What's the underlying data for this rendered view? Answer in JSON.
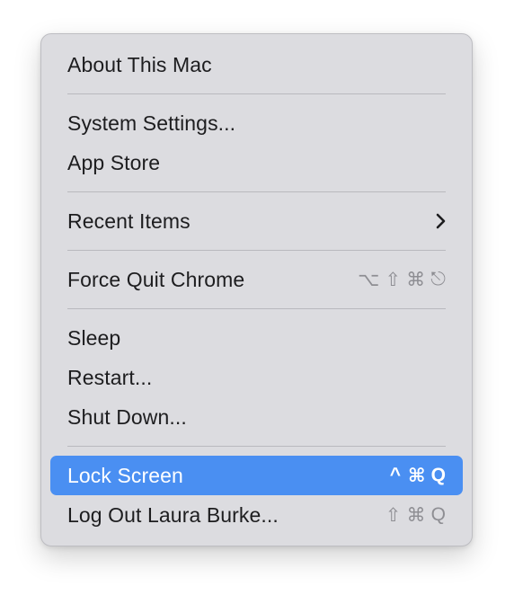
{
  "menu": {
    "items": [
      {
        "label": "About This Mac"
      },
      {
        "label": "System Settings..."
      },
      {
        "label": "App Store"
      },
      {
        "label": "Recent Items",
        "submenu_icon": "chevron-right-icon"
      },
      {
        "label": "Force Quit Chrome",
        "shortcut": [
          "⌥",
          "⇧",
          "⌘",
          "⎋"
        ]
      },
      {
        "label": "Sleep"
      },
      {
        "label": "Restart..."
      },
      {
        "label": "Shut Down..."
      },
      {
        "label": "Lock Screen",
        "shortcut": [
          "^",
          "⌘",
          "Q"
        ],
        "highlighted": true
      },
      {
        "label": "Log Out Laura Burke...",
        "shortcut": [
          "⇧",
          "⌘",
          "Q"
        ]
      }
    ]
  },
  "colors": {
    "menu_background": "#dcdce0",
    "highlight": "#4a8ff2",
    "shortcut_text": "#8e8e93",
    "separator": "#b9b9be"
  }
}
